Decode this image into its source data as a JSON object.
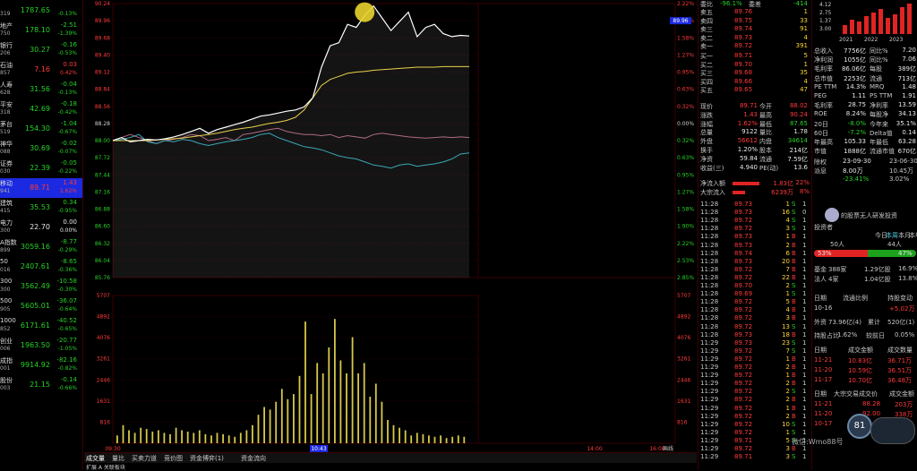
{
  "stock_list": [
    {
      "name": "",
      "code": "319",
      "price": "1787.65",
      "change": "",
      "pct": "-0.13%",
      "pc": "grn"
    },
    {
      "name": "地产",
      "code": "750",
      "price": "178.10",
      "change": "-2.51",
      "pct": "-1.39%",
      "pc": "grn"
    },
    {
      "name": "银行",
      "code": "206",
      "price": "30.27",
      "change": "-0.16",
      "pct": "-0.53%",
      "pc": "grn"
    },
    {
      "name": "石油",
      "code": "857",
      "price": "7.16",
      "change": "0.03",
      "pct": "0.42%",
      "pc": "red"
    },
    {
      "name": "人寿",
      "code": "628",
      "price": "31.56",
      "change": "-0.04",
      "pct": "-0.13%",
      "pc": "grn"
    },
    {
      "name": "平安",
      "code": "318",
      "price": "42.69",
      "change": "-0.18",
      "pct": "-0.42%",
      "pc": "grn"
    },
    {
      "name": "茅台",
      "code": "519",
      "price": "154.30",
      "change": "-1.04",
      "pct": "-0.67%",
      "pc": "grn"
    },
    {
      "name": "神华",
      "code": "088",
      "price": "30.69",
      "change": "-0.02",
      "pct": "-0.07%",
      "pc": "grn"
    },
    {
      "name": "证券",
      "code": "030",
      "price": "22.39",
      "change": "-0.05",
      "pct": "-0.22%",
      "pc": "grn"
    },
    {
      "name": "移动",
      "code": "941",
      "price": "89.71",
      "change": "1.43",
      "pct": "1.62%",
      "pc": "red",
      "sel": true
    },
    {
      "name": "建筑",
      "code": "415",
      "price": "35.53",
      "change": "0.34",
      "pct": "-0.95%",
      "pc": "grn"
    },
    {
      "name": "电力",
      "code": "300",
      "price": "22.70",
      "change": "0.00",
      "pct": "0.00%",
      "pc": "wht"
    },
    {
      "name": "A指数",
      "code": "899",
      "price": "3059.16",
      "change": "-8.77",
      "pct": "-0.29%",
      "pc": "grn"
    },
    {
      "name": "50",
      "code": "016",
      "price": "2407.61",
      "change": "-8.65",
      "pct": "-0.36%",
      "pc": "grn"
    },
    {
      "name": "300",
      "code": "300",
      "price": "3562.49",
      "change": "-10.58",
      "pct": "-0.30%",
      "pc": "grn"
    },
    {
      "name": "500",
      "code": "905",
      "price": "5605.01",
      "change": "-36.07",
      "pct": "-0.64%",
      "pc": "grn"
    },
    {
      "name": "1000",
      "code": "852",
      "price": "6171.61",
      "change": "-40.52",
      "pct": "-0.65%",
      "pc": "grn"
    },
    {
      "name": "创业",
      "code": "006",
      "price": "1963.50",
      "change": "-20.77",
      "pct": "-1.05%",
      "pc": "grn"
    },
    {
      "name": "成指",
      "code": "001",
      "price": "9914.92",
      "change": "-82.16",
      "pct": "-0.82%",
      "pc": "grn"
    },
    {
      "name": "股份",
      "code": "003",
      "price": "21.15",
      "change": "-0.14",
      "pct": "-0.66%",
      "pc": "grn"
    }
  ],
  "chart_data": {
    "type": "line",
    "price_axis": [
      "90.24",
      "89.96",
      "89.68",
      "89.40",
      "89.12",
      "88.84",
      "88.56",
      "88.28",
      "88.00",
      "87.72",
      "87.44",
      "87.16",
      "86.88",
      "86.60",
      "86.32",
      "86.04",
      "85.76"
    ],
    "pct_axis": [
      "2.22%",
      "1.90%",
      "1.58%",
      "1.27%",
      "0.95%",
      "0.63%",
      "0.32%",
      "0.00%",
      "0.32%",
      "0.63%",
      "0.95%",
      "1.27%",
      "1.58%",
      "1.90%",
      "2.22%",
      "2.53%",
      "2.85%"
    ],
    "volume_axis": [
      "5707",
      "4892",
      "4076",
      "3261",
      "2446",
      "1631",
      "816"
    ],
    "current_price_label": "89.96",
    "time_labels": [
      "09:30",
      "",
      "10:43",
      "",
      "14:00",
      "16:00"
    ],
    "price_series": [
      88.0,
      88.05,
      87.98,
      88.0,
      88.02,
      88.01,
      88.03,
      88.06,
      88.1,
      88.15,
      88.2,
      88.12,
      88.18,
      88.22,
      88.26,
      88.3,
      88.35,
      88.4,
      88.42,
      88.45,
      88.48,
      88.5,
      88.55,
      88.7,
      89.2,
      89.55,
      89.6,
      89.9,
      89.85,
      90.05,
      90.2,
      90.0,
      89.8,
      89.95,
      90.1,
      89.7,
      89.85,
      89.9,
      89.75,
      89.7,
      89.72,
      89.71
    ],
    "avg_series": [
      88.0,
      88.0,
      88.0,
      88.0,
      88.0,
      88.01,
      88.02,
      88.03,
      88.04,
      88.06,
      88.08,
      88.1,
      88.12,
      88.15,
      88.18,
      88.2,
      88.22,
      88.25,
      88.28,
      88.3,
      88.33,
      88.38,
      88.5,
      88.7,
      88.9,
      89.0,
      89.05,
      89.1,
      89.12,
      89.13,
      89.15,
      89.16,
      89.17,
      89.18,
      89.19,
      89.2,
      89.2,
      89.2,
      89.21,
      89.21,
      89.21,
      89.21
    ],
    "pink_series": [
      88.0,
      88.05,
      88.1,
      88.05,
      88.0,
      87.95,
      88.0,
      88.02,
      88.05,
      88.1,
      88.08,
      88.0,
      88.02,
      88.05,
      88.0,
      88.1,
      88.12,
      88.15,
      88.18,
      88.2,
      88.15,
      88.12,
      88.1,
      88.1,
      88.08,
      88.1,
      88.05,
      88.08,
      88.06,
      88.04,
      88.1,
      88.12,
      88.1,
      88.08,
      88.06,
      88.05,
      88.04,
      88.05,
      88.06,
      88.05,
      88.06,
      88.05
    ],
    "cyan_series": [
      88.0,
      88.02,
      88.05,
      88.1,
      87.98,
      87.95,
      88.0,
      87.98,
      88.02,
      88.0,
      87.95,
      87.92,
      87.95,
      87.98,
      88.0,
      88.02,
      88.05,
      88.1,
      88.12,
      88.05,
      88.0,
      87.95,
      87.9,
      87.88,
      87.85,
      87.8,
      87.75,
      87.72,
      87.7,
      87.65,
      87.6,
      87.58,
      87.55,
      87.6,
      87.62,
      87.58,
      87.6,
      87.62,
      87.65,
      87.7,
      87.78,
      87.8
    ],
    "volume_series": [
      300,
      700,
      500,
      400,
      600,
      550,
      450,
      500,
      400,
      350,
      600,
      500,
      450,
      400,
      500,
      350,
      300,
      400,
      350,
      300,
      250,
      400,
      500,
      700,
      1100,
      1400,
      1300,
      1600,
      2100,
      1700,
      1900,
      2600,
      4700,
      1900,
      3100,
      2700,
      3700,
      4800,
      3200,
      2700,
      4100,
      2700,
      3100,
      1800,
      2300,
      1600,
      900,
      700,
      600,
      500,
      300,
      400,
      350,
      300,
      250,
      300,
      200,
      250,
      300,
      250
    ]
  },
  "chart_tabs": [
    "成交量",
    "量比",
    "买卖力道",
    "竞价图",
    "资金博弈(1)",
    "资金流向"
  ],
  "chart_tabs_bottom": "扩展 A 关联板块",
  "chart_badge": "画线",
  "orderbook": {
    "header": {
      "label": "委比",
      "value": "-96.1%",
      "label2": "委差",
      "value2": "-414"
    },
    "sells": [
      {
        "l": "卖五",
        "p": "89.76",
        "v": "1"
      },
      {
        "l": "卖四",
        "p": "89.75",
        "v": "33"
      },
      {
        "l": "卖三",
        "p": "89.74",
        "v": "91"
      },
      {
        "l": "卖二",
        "p": "89.73",
        "v": "4"
      },
      {
        "l": "卖一",
        "p": "89.72",
        "v": "391"
      }
    ],
    "buys": [
      {
        "l": "买一",
        "p": "89.71",
        "v": "5"
      },
      {
        "l": "买二",
        "p": "89.70",
        "v": "1"
      },
      {
        "l": "买三",
        "p": "89.68",
        "v": "35"
      },
      {
        "l": "买四",
        "p": "89.66",
        "v": "4"
      },
      {
        "l": "买五",
        "p": "89.65",
        "v": "47"
      }
    ],
    "stats": [
      {
        "a": "现价",
        "av": "89.71",
        "b": "今开",
        "bv": "88.02"
      },
      {
        "a": "涨跌",
        "av": "1.43",
        "b": "最高",
        "bv": "90.24"
      },
      {
        "a": "涨幅",
        "av": "1.62%",
        "b": "最低",
        "bv": "87.65"
      },
      {
        "a": "总量",
        "av": "9122",
        "b": "量比",
        "bv": "1.78"
      },
      {
        "a": "外盘",
        "av": "56612",
        "b": "内盘",
        "bv": "34614"
      },
      {
        "a": "换手",
        "av": "1.20%",
        "b": "股本",
        "bv": "214亿"
      },
      {
        "a": "净资",
        "av": "59.84",
        "b": "流通",
        "bv": "7.59亿"
      },
      {
        "a": "收益(三)",
        "av": "4.940",
        "b": "PE(动)",
        "bv": "13.6"
      }
    ],
    "flows": [
      {
        "l": "净流入额",
        "v": "1.83亿",
        "p": "22%"
      },
      {
        "l": "大宗流入",
        "v": "6239万",
        "p": "8%"
      }
    ],
    "ticks": [
      {
        "t": "11:28",
        "p": "89.73",
        "v": "1",
        "d": "S",
        "n": "1"
      },
      {
        "t": "11:28",
        "p": "89.73",
        "v": "16",
        "d": "S",
        "n": "0"
      },
      {
        "t": "11:28",
        "p": "89.72",
        "v": "4",
        "d": "S",
        "n": "1"
      },
      {
        "t": "11:28",
        "p": "89.72",
        "v": "3",
        "d": "S",
        "n": "1"
      },
      {
        "t": "11:28",
        "p": "89.73",
        "v": "1",
        "d": "B",
        "n": "1"
      },
      {
        "t": "11:28",
        "p": "89.73",
        "v": "2",
        "d": "B",
        "n": "1"
      },
      {
        "t": "11:28",
        "p": "89.74",
        "v": "6",
        "d": "B",
        "n": "1"
      },
      {
        "t": "11:28",
        "p": "89.73",
        "v": "20",
        "d": "B",
        "n": "1"
      },
      {
        "t": "11:28",
        "p": "89.72",
        "v": "7",
        "d": "B",
        "n": "1"
      },
      {
        "t": "11:28",
        "p": "89.72",
        "v": "22",
        "d": "B",
        "n": "1"
      },
      {
        "t": "11:28",
        "p": "89.70",
        "v": "2",
        "d": "S",
        "n": "1"
      },
      {
        "t": "11:28",
        "p": "89.69",
        "v": "1",
        "d": "S",
        "n": "1"
      },
      {
        "t": "11:28",
        "p": "89.72",
        "v": "5",
        "d": "B",
        "n": "1"
      },
      {
        "t": "11:28",
        "p": "89.72",
        "v": "4",
        "d": "B",
        "n": "1"
      },
      {
        "t": "11:28",
        "p": "89.72",
        "v": "3",
        "d": "B",
        "n": "1"
      },
      {
        "t": "11:28",
        "p": "89.72",
        "v": "13",
        "d": "S",
        "n": "1"
      },
      {
        "t": "11:28",
        "p": "89.73",
        "v": "18",
        "d": "B",
        "n": "1"
      },
      {
        "t": "11:29",
        "p": "89.73",
        "v": "23",
        "d": "S",
        "n": "1"
      },
      {
        "t": "11:29",
        "p": "89.72",
        "v": "7",
        "d": "S",
        "n": "1"
      },
      {
        "t": "11:29",
        "p": "89.72",
        "v": "1",
        "d": "B",
        "n": "1"
      },
      {
        "t": "11:29",
        "p": "89.72",
        "v": "2",
        "d": "B",
        "n": "1"
      },
      {
        "t": "11:29",
        "p": "89.72",
        "v": "1",
        "d": "B",
        "n": "1"
      },
      {
        "t": "11:29",
        "p": "89.72",
        "v": "2",
        "d": "B",
        "n": "1"
      },
      {
        "t": "11:29",
        "p": "89.72",
        "v": "2",
        "d": "S",
        "n": "1"
      },
      {
        "t": "11:29",
        "p": "89.72",
        "v": "2",
        "d": "B",
        "n": "1"
      },
      {
        "t": "11:29",
        "p": "89.72",
        "v": "1",
        "d": "B",
        "n": "1"
      },
      {
        "t": "11:29",
        "p": "89.72",
        "v": "2",
        "d": "B",
        "n": "1"
      },
      {
        "t": "11:29",
        "p": "89.72",
        "v": "10",
        "d": "S",
        "n": "1"
      },
      {
        "t": "11:29",
        "p": "89.72",
        "v": "1",
        "d": "S",
        "n": "1"
      },
      {
        "t": "11:29",
        "p": "89.71",
        "v": "5",
        "d": "S",
        "n": "1"
      },
      {
        "t": "11:29",
        "p": "89.72",
        "v": "3",
        "d": "B",
        "n": "1"
      },
      {
        "t": "11:29",
        "p": "89.71",
        "v": "3",
        "d": "S",
        "n": "1"
      }
    ]
  },
  "info": {
    "mini_chart_axis": [
      "4.12",
      "2.75",
      "1.37",
      "3.00"
    ],
    "years": [
      "2021",
      "2022",
      "2023"
    ],
    "metrics": [
      {
        "a": "总收入",
        "av": "7756亿",
        "b": "同比%",
        "bv": "7.20"
      },
      {
        "a": "净利润",
        "av": "1055亿",
        "b": "同比%",
        "bv": "7.06"
      },
      {
        "a": "毛利率",
        "av": "86.06亿",
        "b": "每股",
        "bv": "389亿"
      },
      {
        "a": "总市值",
        "av": "2253亿",
        "b": "流通",
        "bv": "713亿"
      },
      {
        "a": "PE TTM",
        "av": "14.3%",
        "b": "MRQ",
        "bv": "1.48"
      },
      {
        "a": "PEG",
        "av": "1.11",
        "b": "PS TTM",
        "bv": "1.91"
      },
      {
        "a": "毛利率",
        "av": "28.75",
        "b": "净利率",
        "bv": "13.59"
      },
      {
        "a": "ROE",
        "av": "8.24%",
        "b": "每股净",
        "bv": "34.13"
      },
      {
        "a": "20日",
        "av": "-8.0%",
        "b": "今年来",
        "bv": "35.1%"
      },
      {
        "a": "60日",
        "av": "-7.2%",
        "b": "Delta值",
        "bv": "0.14"
      },
      {
        "a": "年最高",
        "av": "105.33",
        "b": "年最低",
        "bv": "63.28"
      },
      {
        "a": "市值",
        "av": "1888亿",
        "b": "流通市值",
        "bv": "670亿"
      }
    ],
    "dividend": [
      {
        "a": "除权",
        "av": "23-09-30",
        "bv": "23-06-30"
      },
      {
        "a": "派息",
        "av": "8.00万",
        "bv": "10.45万"
      },
      {
        "a": "",
        "av": "-23.41%",
        "bv": "3.02%"
      }
    ],
    "community": {
      "title": "市场",
      "text": "的股票无人研发投资",
      "user": "投资者"
    },
    "ratio": {
      "left_label": "今日",
      "a": "今日",
      "b": "本周",
      "c": "本月",
      "d": "本年"
    },
    "votes": {
      "bull": "50人",
      "bear": "44人",
      "bull_pct": "53%",
      "bear_pct": "47%"
    },
    "holders": [
      {
        "a": "基金",
        "av": "388家",
        "b": "1.29亿股",
        "bv": "16.9%"
      },
      {
        "a": "法人",
        "av": "4家",
        "b": "1.04亿股",
        "bv": "13.8%"
      }
    ],
    "flow_table_header": {
      "a": "日期",
      "b": "流通比例",
      "c": "持股变动"
    },
    "flow_table": [
      {
        "d": "10-16",
        "v": "",
        "c": "+5.02万"
      }
    ],
    "southbound": {
      "a": "外资",
      "av": "73.96亿(4)",
      "b": "累计",
      "bv": "520亿(1)"
    },
    "south_pct": {
      "a": "持股占比",
      "av": "1.62%",
      "b": "较前日",
      "bv": "0.05%"
    },
    "trades_header": {
      "a": "日期",
      "b": "成交金额",
      "c": "成交数量"
    },
    "trades": [
      {
        "d": "11-21",
        "a": "10.83亿",
        "b": "36.71万"
      },
      {
        "d": "11-20",
        "a": "10.59亿",
        "b": "36.51万"
      },
      {
        "d": "11-17",
        "a": "10.70亿",
        "b": "36.48万"
      }
    ],
    "big_header": {
      "a": "日期",
      "b": "大宗交易成交价",
      "c": "成交金额"
    },
    "big": [
      {
        "d": "11-21",
        "a": "88.28",
        "b": "203万"
      },
      {
        "d": "11-20",
        "a": "92.00",
        "b": "338万"
      },
      {
        "d": "10-17",
        "a": "",
        "b": "170万"
      }
    ],
    "badge_number": "81",
    "watermark": "微信:Wmo88号"
  }
}
